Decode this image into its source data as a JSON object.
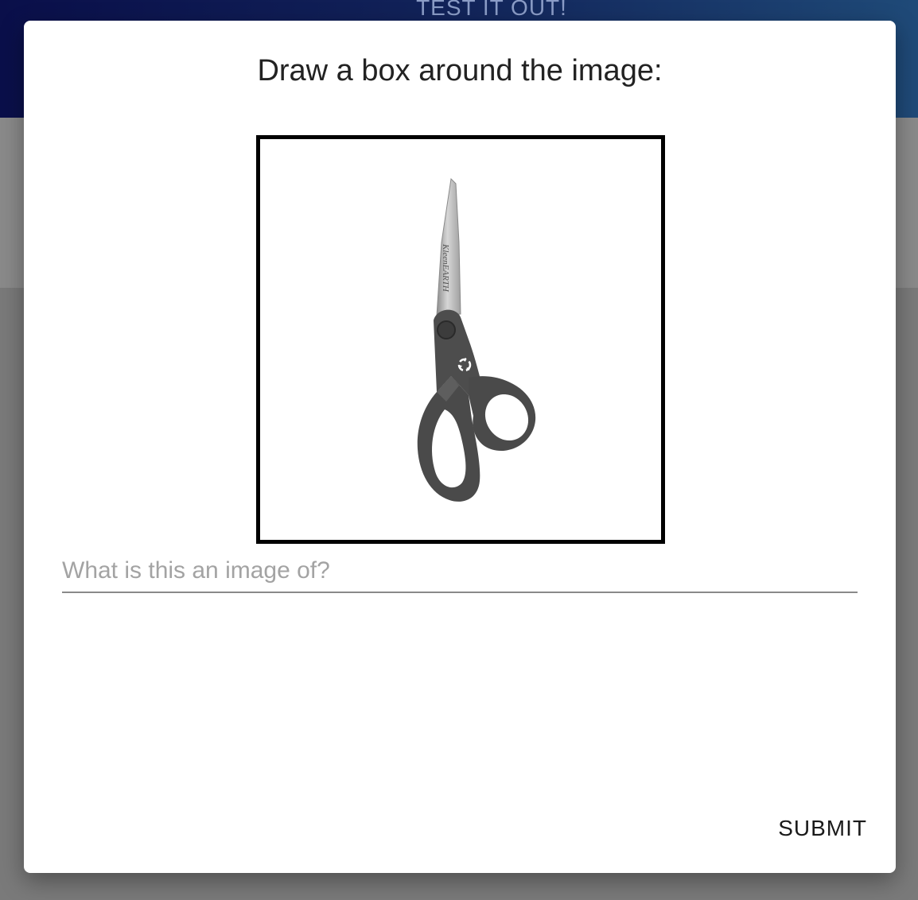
{
  "background": {
    "banner_title": "TEST IT OUT!"
  },
  "modal": {
    "title": "Draw a box around the image:",
    "image": {
      "subject": "scissors",
      "brand_text": "KleenEARTH"
    },
    "answer_field": {
      "placeholder": "What is this an image of?",
      "value": ""
    },
    "submit_label": "SUBMIT"
  },
  "colors": {
    "banner_dark": "#0a0f4a",
    "banner_light": "#1f4a78",
    "overlay_gray": "#7a7a7a",
    "frame_border": "#000000",
    "scissor_handle": "#4a4a4a"
  }
}
